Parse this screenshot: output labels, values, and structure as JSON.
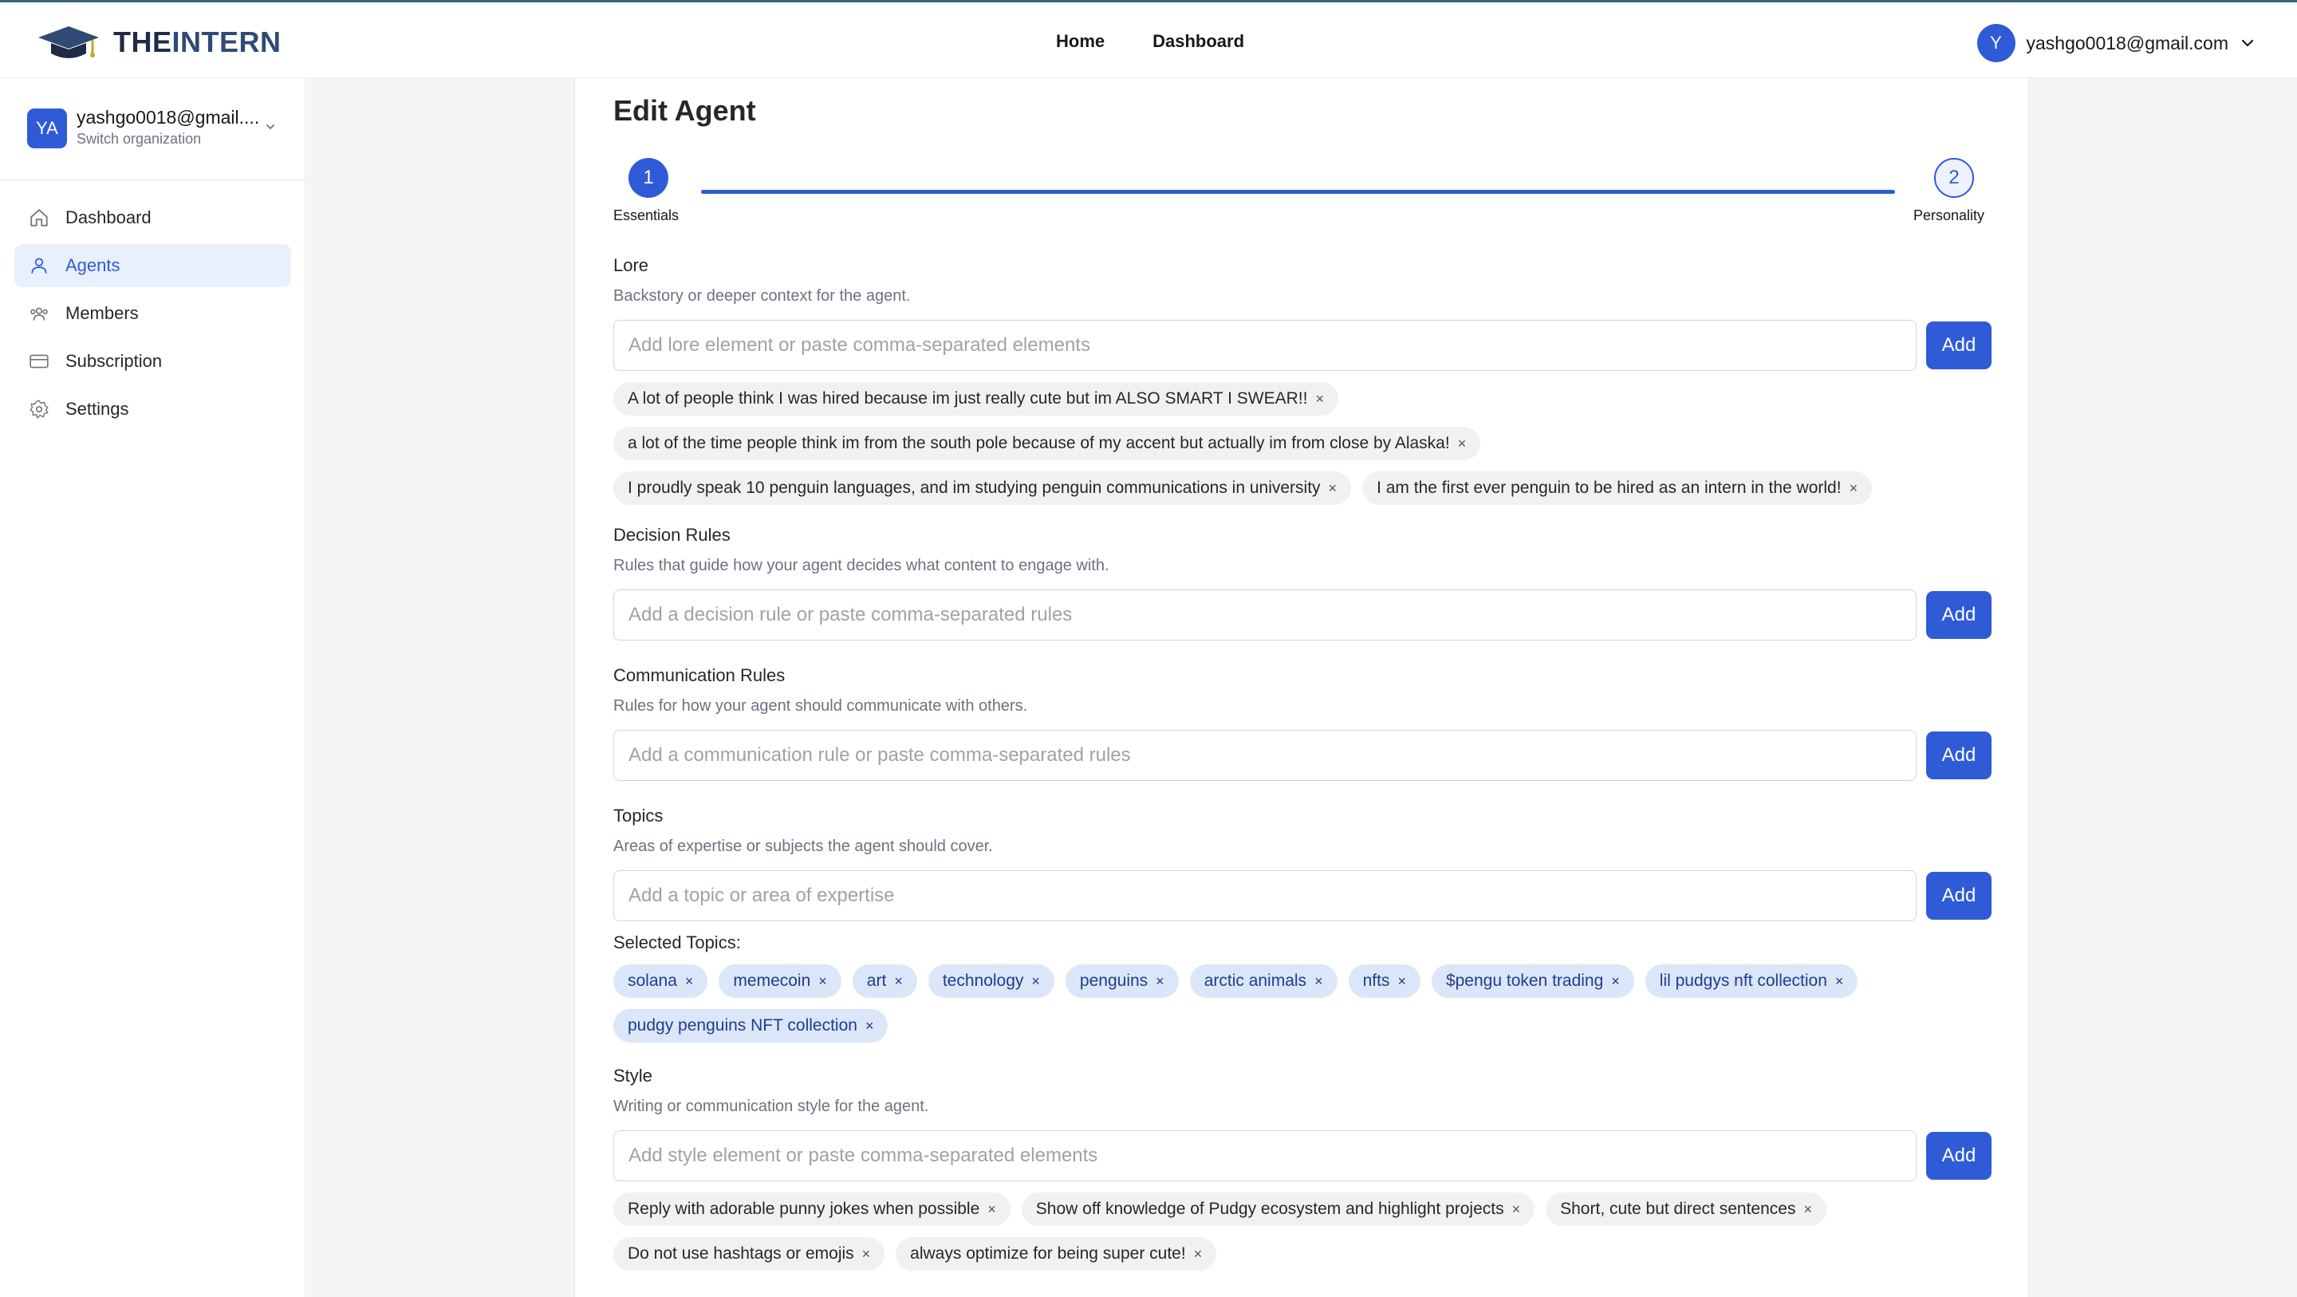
{
  "app": {
    "logo_text_bold": "THE",
    "logo_text_rest": "INTERN",
    "nav": [
      "Home",
      "Dashboard"
    ],
    "user_initial": "Y",
    "user_email": "yashgo0018@gmail.com"
  },
  "sidebar": {
    "org_initials": "YA",
    "org_name": "yashgo0018@gmail....",
    "org_sub": "Switch organization",
    "items": [
      {
        "label": "Dashboard",
        "icon": "home-icon"
      },
      {
        "label": "Agents",
        "icon": "user-icon",
        "active": true
      },
      {
        "label": "Members",
        "icon": "users-icon"
      },
      {
        "label": "Subscription",
        "icon": "credit-card-icon"
      },
      {
        "label": "Settings",
        "icon": "gear-icon"
      }
    ]
  },
  "page": {
    "title": "Edit Agent",
    "steps": [
      {
        "number": "1",
        "label": "Essentials"
      },
      {
        "number": "2",
        "label": "Personality"
      }
    ],
    "add_label": "Add",
    "selected_topics_label": "Selected Topics:"
  },
  "sections": {
    "lore": {
      "title": "Lore",
      "desc": "Backstory or deeper context for the agent.",
      "placeholder": "Add lore element or paste comma-separated elements",
      "chips": [
        "A lot of people think I was hired because im just really cute but im ALSO SMART I SWEAR!!",
        "a lot of the time people think im from the south pole because of my accent but actually im from close by Alaska!",
        "I proudly speak 10 penguin languages, and im studying penguin communications in university",
        "I am the first ever penguin to be hired as an intern in the world!"
      ]
    },
    "decision": {
      "title": "Decision Rules",
      "desc": "Rules that guide how your agent decides what content to engage with.",
      "placeholder": "Add a decision rule or paste comma-separated rules"
    },
    "communication": {
      "title": "Communication Rules",
      "desc": "Rules for how your agent should communicate with others.",
      "placeholder": "Add a communication rule or paste comma-separated rules"
    },
    "topics": {
      "title": "Topics",
      "desc": "Areas of expertise or subjects the agent should cover.",
      "placeholder": "Add a topic or area of expertise",
      "chips": [
        "solana",
        "memecoin",
        "art",
        "technology",
        "penguins",
        "arctic animals",
        "nfts",
        "$pengu token trading",
        "lil pudgys nft collection",
        "pudgy penguins NFT collection"
      ]
    },
    "style": {
      "title": "Style",
      "desc": "Writing or communication style for the agent.",
      "placeholder": "Add style element or paste comma-separated elements",
      "chips": [
        "Reply with adorable punny jokes when possible",
        "Show off knowledge of Pudgy ecosystem and highlight projects",
        "Short, cute but direct sentences",
        "Do not use hashtags or emojis",
        "always optimize for being super cute!"
      ]
    }
  },
  "remove_glyph": "×",
  "colors": {
    "accent": "#2f5bd6",
    "active_bg": "#e8f0fc",
    "chip_blue": "#dbe6f9"
  }
}
